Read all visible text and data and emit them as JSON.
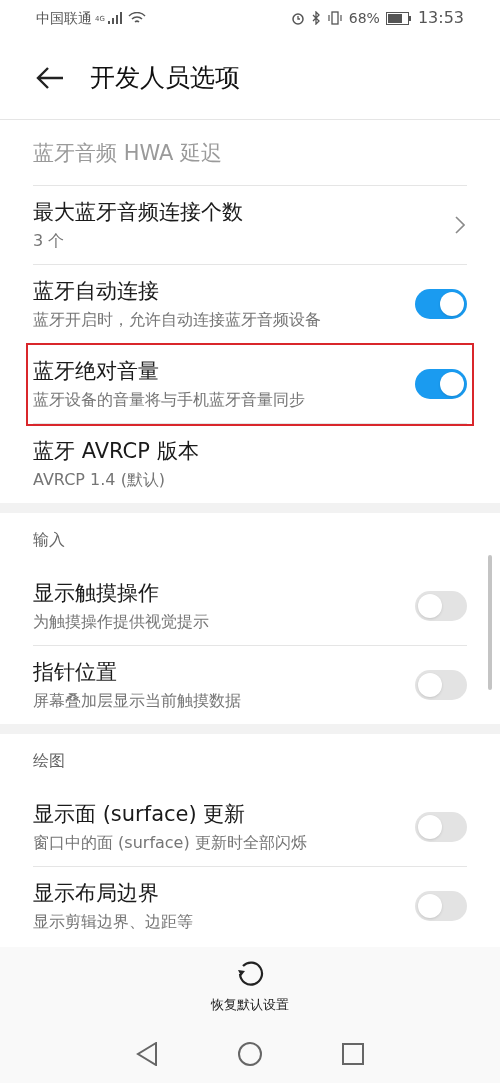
{
  "status_bar": {
    "carrier": "中国联通",
    "network": "4G",
    "battery": "68%",
    "time": "13:53"
  },
  "header": {
    "title": "开发人员选项"
  },
  "sections": [
    {
      "items": [
        {
          "kind": "plain",
          "title": "蓝牙音频 HWA 延迟",
          "disabled": true,
          "highlighted": false
        },
        {
          "kind": "link",
          "title": "最大蓝牙音频连接个数",
          "subtitle": "3 个",
          "disabled": false,
          "highlighted": false
        },
        {
          "kind": "toggle",
          "title": "蓝牙自动连接",
          "subtitle": "蓝牙开启时，允许自动连接蓝牙音频设备",
          "on": true,
          "disabled": false,
          "highlighted": false
        },
        {
          "kind": "toggle",
          "title": "蓝牙绝对音量",
          "subtitle": "蓝牙设备的音量将与手机蓝牙音量同步",
          "on": true,
          "disabled": false,
          "highlighted": true
        },
        {
          "kind": "plain",
          "title": "蓝牙 AVRCP 版本",
          "subtitle": "AVRCP 1.4 (默认)",
          "disabled": false,
          "highlighted": false
        }
      ]
    },
    {
      "header": "输入",
      "items": [
        {
          "kind": "toggle",
          "title": "显示触摸操作",
          "subtitle": "为触摸操作提供视觉提示",
          "on": false,
          "disabled": false,
          "highlighted": false
        },
        {
          "kind": "toggle",
          "title": "指针位置",
          "subtitle": "屏幕叠加层显示当前触摸数据",
          "on": false,
          "disabled": false,
          "highlighted": false
        }
      ]
    },
    {
      "header": "绘图",
      "items": [
        {
          "kind": "toggle",
          "title": "显示面 (surface) 更新",
          "subtitle": "窗口中的面 (surface) 更新时全部闪烁",
          "on": false,
          "disabled": false,
          "highlighted": false
        },
        {
          "kind": "toggle",
          "title": "显示布局边界",
          "subtitle": "显示剪辑边界、边距等",
          "on": false,
          "disabled": false,
          "highlighted": false
        }
      ]
    }
  ],
  "footer": {
    "reset_label": "恢复默认设置"
  }
}
